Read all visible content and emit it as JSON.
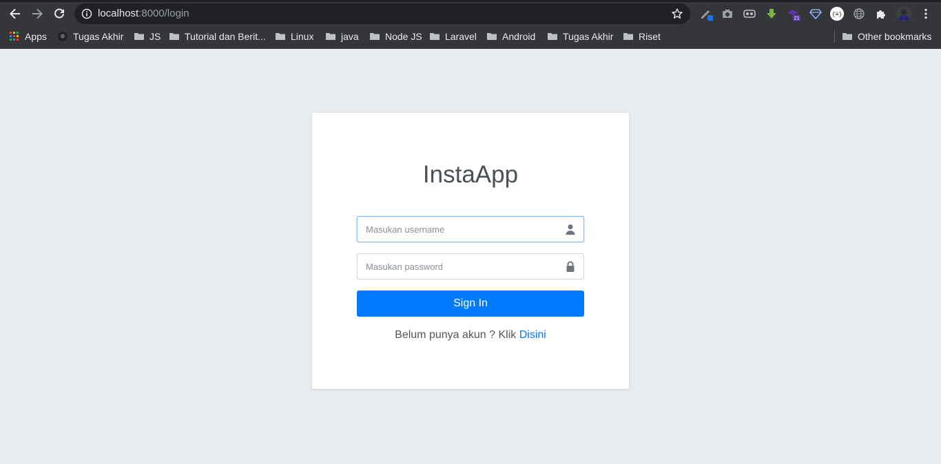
{
  "browser": {
    "url_host": "localhost",
    "url_path": ":8000/login",
    "bookmarks": [
      {
        "label": "Apps",
        "icon": "apps-grid-icon"
      },
      {
        "label": "Tugas Akhir",
        "icon": "github-icon"
      },
      {
        "label": "JS",
        "icon": "folder-icon"
      },
      {
        "label": "Tutorial dan Berit...",
        "icon": "folder-icon"
      },
      {
        "label": "Linux",
        "icon": "folder-icon"
      },
      {
        "label": "java",
        "icon": "folder-icon"
      },
      {
        "label": "Node JS",
        "icon": "folder-icon"
      },
      {
        "label": "Laravel",
        "icon": "folder-icon"
      },
      {
        "label": "Android",
        "icon": "folder-icon"
      },
      {
        "label": "Tugas Akhir",
        "icon": "folder-icon"
      },
      {
        "label": "Riset",
        "icon": "folder-icon"
      }
    ],
    "other_bookmarks": "Other bookmarks",
    "extension_badge": "21"
  },
  "login": {
    "title": "InstaApp",
    "username_placeholder": "Masukan username",
    "password_placeholder": "Masukan password",
    "submit_label": "Sign In",
    "signup_text": "Belum punya akun ? Klik ",
    "signup_link": "Disini"
  },
  "colors": {
    "accent": "#007bff",
    "page_bg": "#e9ecef",
    "chrome_bg": "#35363a"
  }
}
